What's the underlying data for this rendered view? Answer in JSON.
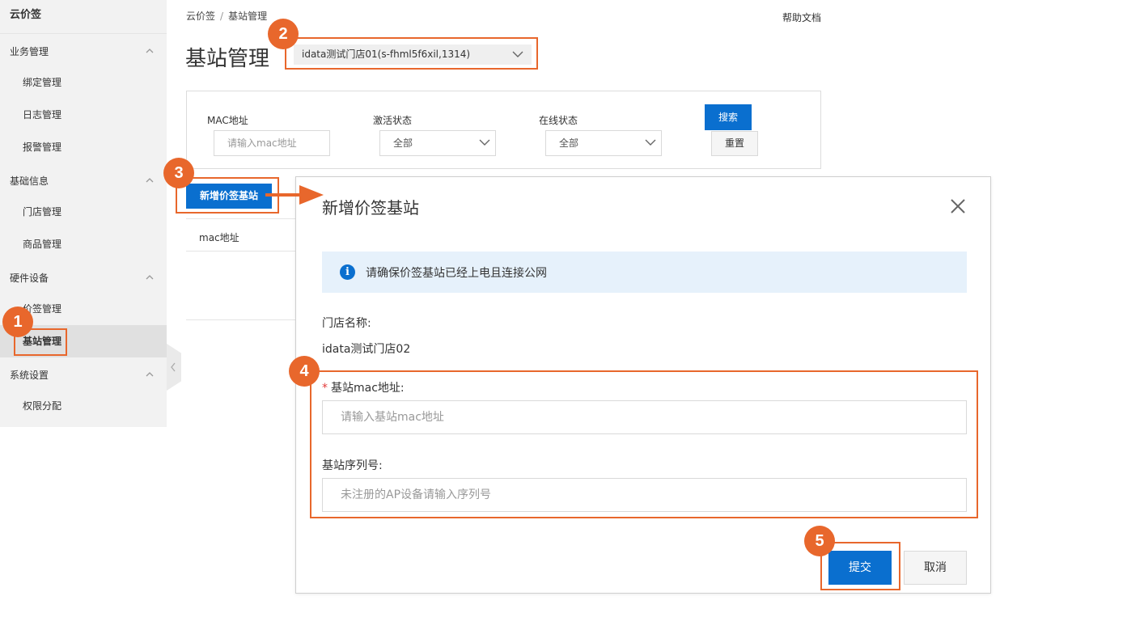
{
  "sidebar": {
    "brand": "云价签",
    "groups": [
      {
        "label": "业务管理",
        "items": [
          "绑定管理",
          "日志管理",
          "报警管理"
        ]
      },
      {
        "label": "基础信息",
        "items": [
          "门店管理",
          "商品管理"
        ]
      },
      {
        "label": "硬件设备",
        "items": [
          "价签管理",
          "基站管理"
        ]
      },
      {
        "label": "系统设置",
        "items": [
          "权限分配"
        ]
      }
    ],
    "active_item": "基站管理"
  },
  "breadcrumb": {
    "root": "云价签",
    "separator": "/",
    "current": "基站管理"
  },
  "help_link": "帮助文档",
  "page": {
    "title": "基站管理",
    "store_select": "idata测试门店01(s-fhml5f6xil,1314)"
  },
  "filters": {
    "mac_label": "MAC地址",
    "mac_placeholder": "请输入mac地址",
    "activation_label": "激活状态",
    "activation_value": "全部",
    "online_label": "在线状态",
    "online_value": "全部",
    "search_button": "搜索",
    "reset_button": "重置"
  },
  "add_button": "新增价签基站",
  "table": {
    "columns": [
      "mac地址"
    ]
  },
  "modal": {
    "title": "新增价签基站",
    "alert": "请确保价签基站已经上电且连接公网",
    "store_name_label": "门店名称:",
    "store_name_value": "idata测试门店02",
    "mac_required_mark": "*",
    "mac_label": "基站mac地址:",
    "mac_placeholder": "请输入基站mac地址",
    "serial_label": "基站序列号:",
    "serial_placeholder": "未注册的AP设备请输入序列号",
    "submit": "提交",
    "cancel": "取消"
  },
  "annotations": {
    "badges": [
      "1",
      "2",
      "3",
      "4",
      "5"
    ],
    "color": "#e8672c"
  },
  "colors": {
    "primary": "#0a6fcf",
    "sidebar_bg": "#f2f2f2",
    "alert_bg": "#e6f1fb",
    "highlight": "#e8672c"
  },
  "icons": [
    "chevron-up-icon",
    "chevron-down-icon",
    "chevron-left-icon",
    "close-icon",
    "info-icon",
    "arrow-right-icon"
  ]
}
